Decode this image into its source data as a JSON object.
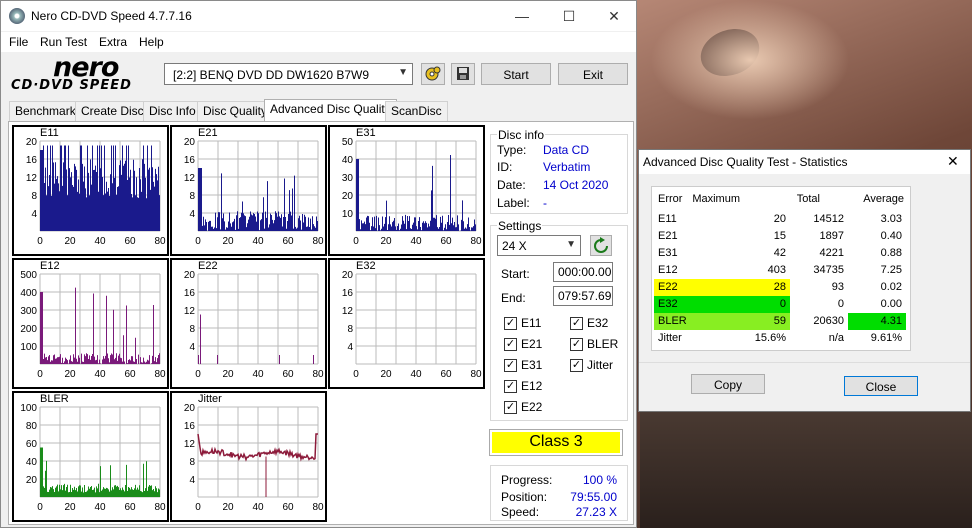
{
  "window": {
    "title": "Nero CD-DVD Speed 4.7.7.16",
    "minimize": "—",
    "maximize": "☐",
    "close": "✕"
  },
  "menu": [
    "File",
    "Run Test",
    "Extra",
    "Help"
  ],
  "logo": {
    "line1": "nero",
    "line2": "CD·DVD SPEED"
  },
  "toolbar": {
    "drive": "[2:2]   BENQ DVD DD DW1620 B7W9",
    "start": "Start",
    "exit": "Exit"
  },
  "tabs": [
    "Benchmark",
    "Create Disc",
    "Disc Info",
    "Disc Quality",
    "Advanced Disc Quality",
    "ScanDisc"
  ],
  "active_tab": 4,
  "graphs": [
    {
      "name": "E11",
      "ylabels": [
        "20",
        "16",
        "12",
        "8",
        "4"
      ],
      "xlabels": [
        "0",
        "20",
        "40",
        "60",
        "80"
      ],
      "color": "#1a1a8c"
    },
    {
      "name": "E21",
      "ylabels": [
        "20",
        "16",
        "12",
        "8",
        "4"
      ],
      "xlabels": [
        "0",
        "20",
        "40",
        "60",
        "80"
      ],
      "color": "#1a1a8c"
    },
    {
      "name": "E31",
      "ylabels": [
        "50",
        "40",
        "30",
        "20",
        "10"
      ],
      "xlabels": [
        "0",
        "20",
        "40",
        "60",
        "80"
      ],
      "color": "#1a1a8c"
    },
    {
      "name": "E12",
      "ylabels": [
        "500",
        "400",
        "300",
        "200",
        "100"
      ],
      "xlabels": [
        "0",
        "20",
        "40",
        "60",
        "80"
      ],
      "color": "#7a1a7a"
    },
    {
      "name": "E22",
      "ylabels": [
        "20",
        "16",
        "12",
        "8",
        "4"
      ],
      "xlabels": [
        "0",
        "20",
        "40",
        "60",
        "80"
      ],
      "color": "#7a1a7a"
    },
    {
      "name": "E32",
      "ylabels": [
        "20",
        "16",
        "12",
        "8",
        "4"
      ],
      "xlabels": [
        "0",
        "20",
        "40",
        "60",
        "80"
      ],
      "color": "#7a1a7a"
    },
    {
      "name": "BLER",
      "ylabels": [
        "100",
        "80",
        "60",
        "40",
        "20"
      ],
      "xlabels": [
        "0",
        "20",
        "40",
        "60",
        "80"
      ],
      "color": "#1a8c1a"
    },
    {
      "name": "Jitter",
      "ylabels": [
        "20",
        "16",
        "12",
        "8",
        "4"
      ],
      "xlabels": [
        "0",
        "20",
        "40",
        "60",
        "80"
      ],
      "color": "#8c1a3a"
    }
  ],
  "disc_info": {
    "title": "Disc info",
    "type_label": "Type:",
    "type": "Data CD",
    "id_label": "ID:",
    "id": "Verbatim",
    "date_label": "Date:",
    "date": "14 Oct 2020",
    "label_label": "Label:",
    "label": "-"
  },
  "settings": {
    "title": "Settings",
    "speed": "24 X",
    "start_label": "Start:",
    "start": "000:00.00",
    "end_label": "End:",
    "end": "079:57.69",
    "checks_left": [
      "E11",
      "E21",
      "E31",
      "E12",
      "E22"
    ],
    "checks_right": [
      "E32",
      "BLER",
      "Jitter"
    ],
    "checkmark": "✓"
  },
  "class_label": "Class 3",
  "class_color": "#ffff00",
  "progress": {
    "progress_label": "Progress:",
    "progress": "100 %",
    "position_label": "Position:",
    "position": "79:55.00",
    "speed_label": "Speed:",
    "speed": "27.23 X"
  },
  "stats": {
    "title": "Advanced Disc Quality Test - Statistics",
    "close": "✕",
    "headers": [
      "Error",
      "Maximum",
      "Total",
      "Average"
    ],
    "rows": [
      {
        "error": "E11",
        "max": "20",
        "total": "14512",
        "avg": "3.03"
      },
      {
        "error": "E21",
        "max": "15",
        "total": "1897",
        "avg": "0.40"
      },
      {
        "error": "E31",
        "max": "42",
        "total": "4221",
        "avg": "0.88"
      },
      {
        "error": "E12",
        "max": "403",
        "total": "34735",
        "avg": "7.25"
      },
      {
        "error": "E22",
        "max": "28",
        "total": "93",
        "avg": "0.02"
      },
      {
        "error": "E32",
        "max": "0",
        "total": "0",
        "avg": "0.00"
      },
      {
        "error": "BLER",
        "max": "59",
        "total": "20630",
        "avg": "4.31"
      },
      {
        "error": "Jitter",
        "max": "15.6%",
        "total": "n/a",
        "avg": "9.61%"
      }
    ],
    "highlight_yellow": "#ffff00",
    "highlight_green": "#00dd00",
    "highlight_lime": "#88ee22",
    "copy": "Copy",
    "close_btn": "Close"
  }
}
